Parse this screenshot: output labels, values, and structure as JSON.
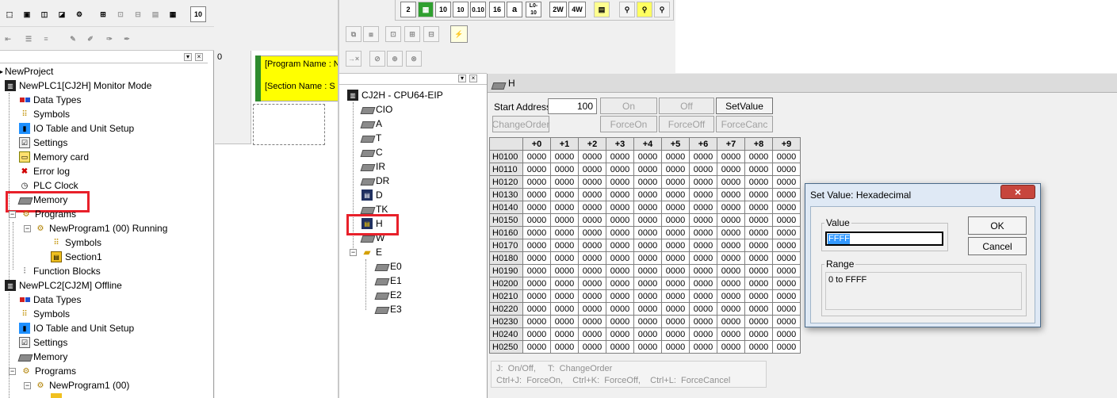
{
  "toolbar": {
    "number_buttons": [
      "2",
      "10",
      "10",
      "16",
      "a",
      "2W",
      "4W"
    ],
    "num_btn_10a": "10",
    "num_btn_1010": "10\n10",
    "num_btn_16a": "16"
  },
  "project_tree": {
    "root": "NewProject",
    "plc1": {
      "title": "NewPLC1[CJ2H] Monitor Mode",
      "items": [
        "Data Types",
        "Symbols",
        "IO Table and Unit Setup",
        "Settings",
        "Memory card",
        "Error log",
        "PLC Clock",
        "Memory"
      ],
      "programs_label": "Programs",
      "program": "NewProgram1 (00) Running",
      "program_children": [
        "Symbols",
        "Section1"
      ],
      "function_blocks": "Function Blocks"
    },
    "plc2": {
      "title": "NewPLC2[CJ2M] Offline",
      "items": [
        "Data Types",
        "Symbols",
        "IO Table and Unit Setup",
        "Settings",
        "Memory"
      ],
      "programs_label": "Programs",
      "program": "NewProgram1 (00)"
    }
  },
  "ladder": {
    "rung_number": "0",
    "program_name": "[Program Name : N",
    "section_name": "[Section Name : S"
  },
  "memory_tree": {
    "root": "CJ2H - CPU64-EIP",
    "areas": [
      "CIO",
      "A",
      "T",
      "C",
      "IR",
      "DR",
      "D",
      "TK",
      "H",
      "W",
      "E"
    ],
    "e_children": [
      "E0",
      "E1",
      "E2",
      "E3"
    ]
  },
  "memory_window": {
    "title": "H",
    "start_address_label": "Start Address:",
    "start_address_value": "100",
    "buttons": {
      "on": "On",
      "off": "Off",
      "set_value": "SetValue",
      "change_order": "ChangeOrder",
      "force_on": "ForceOn",
      "force_off": "ForceOff",
      "force_cancel": "ForceCanc"
    },
    "columns": [
      "+0",
      "+1",
      "+2",
      "+3",
      "+4",
      "+5",
      "+6",
      "+7",
      "+8",
      "+9"
    ],
    "rows": [
      "H0100",
      "H0110",
      "H0120",
      "H0130",
      "H0140",
      "H0150",
      "H0160",
      "H0170",
      "H0180",
      "H0190",
      "H0200",
      "H0210",
      "H0220",
      "H0230",
      "H0240",
      "H0250"
    ],
    "cell_value": "0000",
    "hint_line1": "J:  On/Off,     T:  ChangeOrder",
    "hint_line2": "Ctrl+J:  ForceOn,    Ctrl+K:  ForceOff,    Ctrl+L:  ForceCancel"
  },
  "dialog": {
    "title": "Set Value: Hexadecimal",
    "close_glyph": "×",
    "value_label": "Value",
    "value": "FFFF",
    "ok": "OK",
    "cancel": "Cancel",
    "range_label": "Range",
    "range_text": "0 to FFFF"
  },
  "colors": {
    "highlight_red": "#e8202a",
    "ladder_yellow": "#ffff00",
    "ladder_green": "#2e8b2e",
    "dialog_title_bg": "#dfe9f5",
    "close_red": "#c7463d"
  }
}
